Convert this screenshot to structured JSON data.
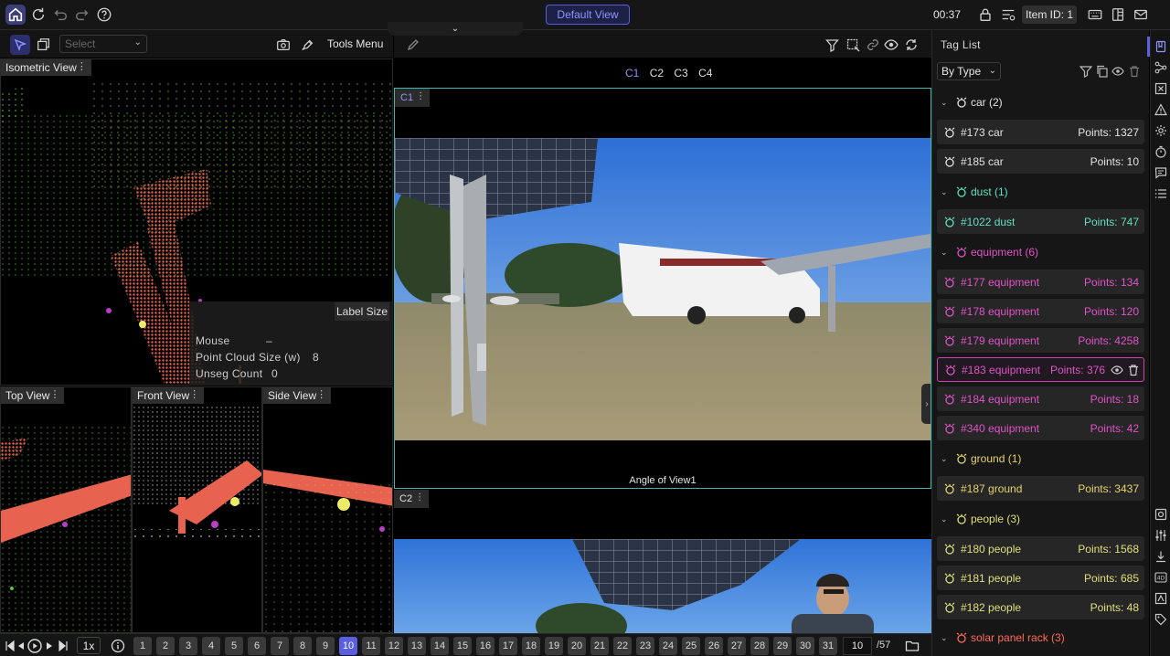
{
  "topbar": {
    "view_button": "Default View",
    "clock": "00:37",
    "item_id": "Item ID: 1"
  },
  "left": {
    "select_placeholder": "Select",
    "tools_menu": "Tools Menu",
    "views": {
      "isometric": "Isometric View",
      "top": "Top View",
      "front": "Front View",
      "side": "Side View"
    },
    "label_size": "Label Size",
    "info": [
      {
        "label": "Mouse",
        "value": "–"
      },
      {
        "label": "Point Cloud Size (w)",
        "value": "8"
      },
      {
        "label": "Unseg Count",
        "value": "0"
      }
    ]
  },
  "center": {
    "cameras": [
      "C1",
      "C2",
      "C3",
      "C4"
    ],
    "active_camera": "C1",
    "c1_label": "C1",
    "c2_label": "C2",
    "angle_label": "Angle of View1"
  },
  "tag_list": {
    "title": "Tag List",
    "group_by": "By Type",
    "colors": {
      "car": "#e3e3e3",
      "dust": "#5fe0c0",
      "equipment": "#e052c8",
      "ground": "#e6d36a",
      "people": "#d9e27a",
      "solar": "#ff6b5a"
    },
    "groups": [
      {
        "name": "car (2)",
        "key": "car",
        "items": [
          {
            "name": "#173 car",
            "points": "Points: 1327"
          },
          {
            "name": "#185 car",
            "points": "Points: 10"
          }
        ]
      },
      {
        "name": "dust (1)",
        "key": "dust",
        "items": [
          {
            "name": "#1022 dust",
            "points": "Points: 747"
          }
        ]
      },
      {
        "name": "equipment (6)",
        "key": "equipment",
        "items": [
          {
            "name": "#177 equipment",
            "points": "Points: 134"
          },
          {
            "name": "#178 equipment",
            "points": "Points: 120"
          },
          {
            "name": "#179 equipment",
            "points": "Points: 4258"
          },
          {
            "name": "#183 equipment",
            "points": "Points: 376",
            "selected": true
          },
          {
            "name": "#184 equipment",
            "points": "Points: 18"
          },
          {
            "name": "#340 equipment",
            "points": "Points: 42"
          }
        ]
      },
      {
        "name": "ground (1)",
        "key": "ground",
        "items": [
          {
            "name": "#187 ground",
            "points": "Points: 3437"
          }
        ]
      },
      {
        "name": "people (3)",
        "key": "people",
        "items": [
          {
            "name": "#180 people",
            "points": "Points: 1568"
          },
          {
            "name": "#181 people",
            "points": "Points: 685"
          },
          {
            "name": "#182 people",
            "points": "Points: 48"
          }
        ]
      },
      {
        "name": "solar panel rack (3)",
        "key": "solar",
        "items": []
      }
    ]
  },
  "bottombar": {
    "speed": "1x",
    "frames": [
      "1",
      "2",
      "3",
      "4",
      "5",
      "6",
      "7",
      "8",
      "9",
      "10",
      "11",
      "12",
      "13",
      "14",
      "15",
      "16",
      "17",
      "18",
      "19",
      "20",
      "21",
      "22",
      "23",
      "24",
      "25",
      "26",
      "27",
      "28",
      "29",
      "30",
      "31"
    ],
    "current_frame": "10",
    "total_frames": "/57"
  }
}
